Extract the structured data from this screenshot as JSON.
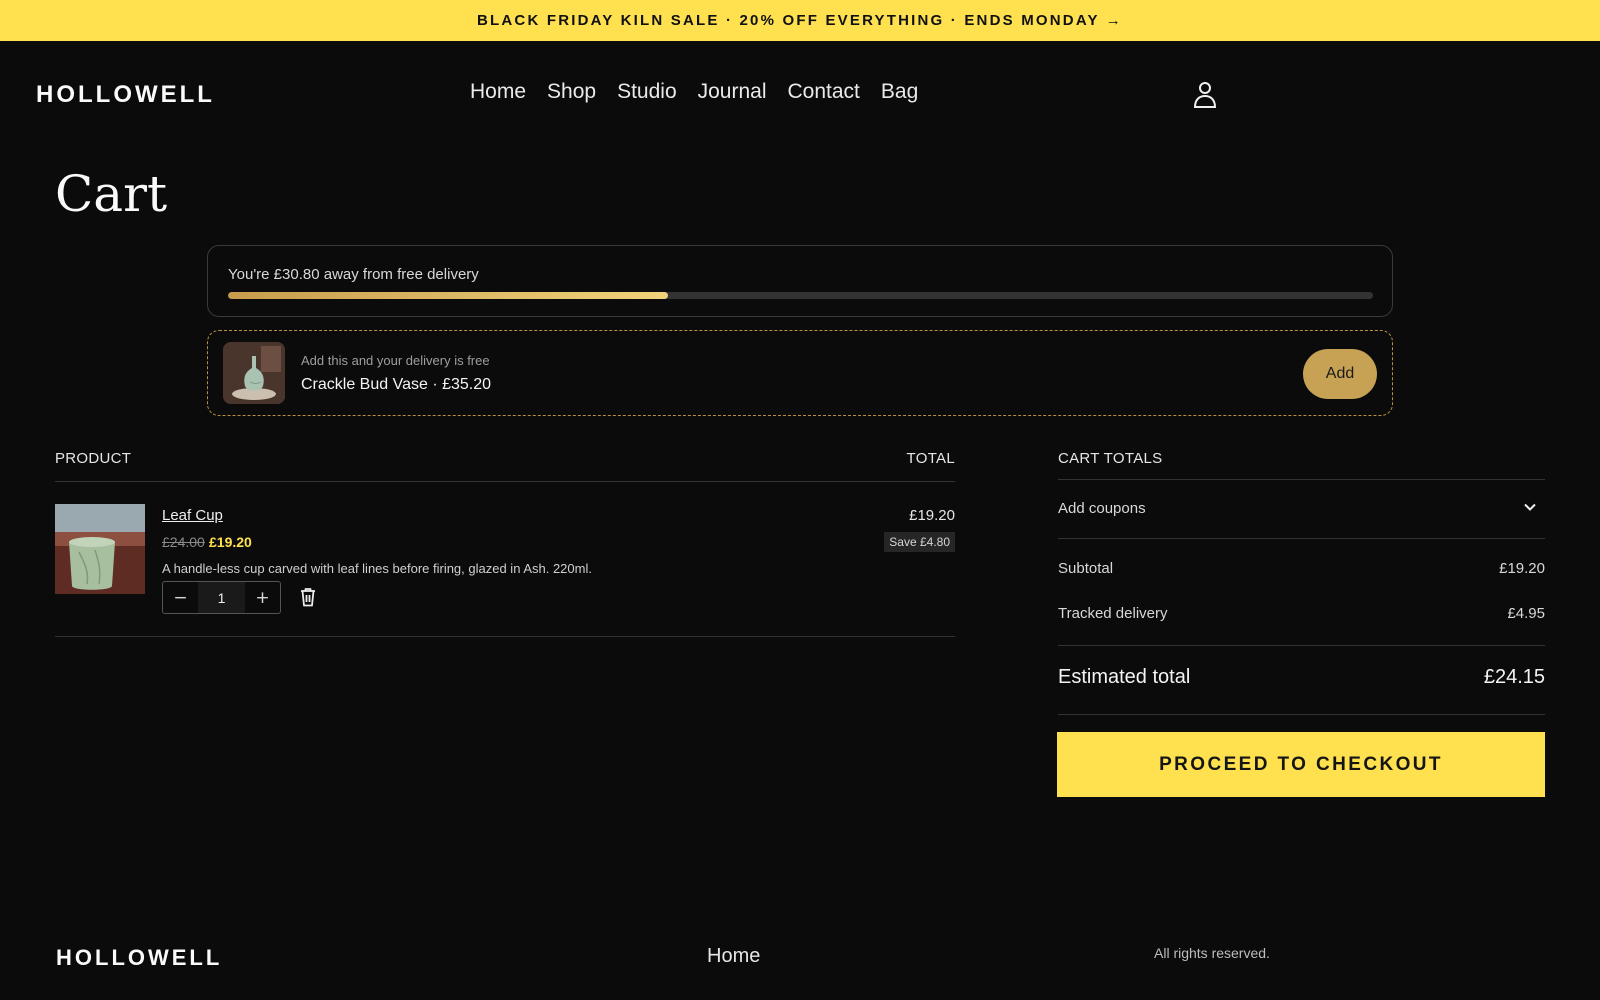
{
  "promo": {
    "text": "BLACK FRIDAY KILN SALE · 20% OFF EVERYTHING · ENDS MONDAY →"
  },
  "header": {
    "logo": "HOLLOWELL",
    "nav": [
      "Home",
      "Shop",
      "Studio",
      "Journal",
      "Contact",
      "Bag"
    ],
    "account_icon": "user-icon"
  },
  "page": {
    "title": "Cart"
  },
  "delivery": {
    "message": "You're £30.80 away from free delivery",
    "progress_percent": 38.4
  },
  "upsell": {
    "kicker": "Add this and your delivery is free",
    "title": "Crackle Bud Vase · £35.20",
    "add_label": "Add"
  },
  "cart": {
    "product_header": "PRODUCT",
    "total_header": "TOTAL",
    "items": [
      {
        "name": "Leaf Cup",
        "old_price": "£24.00",
        "price": "£19.20",
        "description": "A handle-less cup carved with leaf lines before firing, glazed in Ash. 220ml.",
        "quantity": "1",
        "line_total": "£19.20",
        "save": "Save £4.80"
      }
    ]
  },
  "totals": {
    "heading": "CART TOTALS",
    "coupons_label": "Add coupons",
    "subtotal_label": "Subtotal",
    "subtotal": "£19.20",
    "delivery_label": "Tracked delivery",
    "delivery": "£4.95",
    "estimated_label": "Estimated total",
    "estimated": "£24.15",
    "checkout_label": "PROCEED TO CHECKOUT"
  },
  "footer": {
    "logo": "HOLLOWELL",
    "link": "Home",
    "rights": "All rights reserved."
  },
  "colors": {
    "accent": "#ffe14f",
    "gold": "#c8a254",
    "background": "#0b0b0b"
  }
}
